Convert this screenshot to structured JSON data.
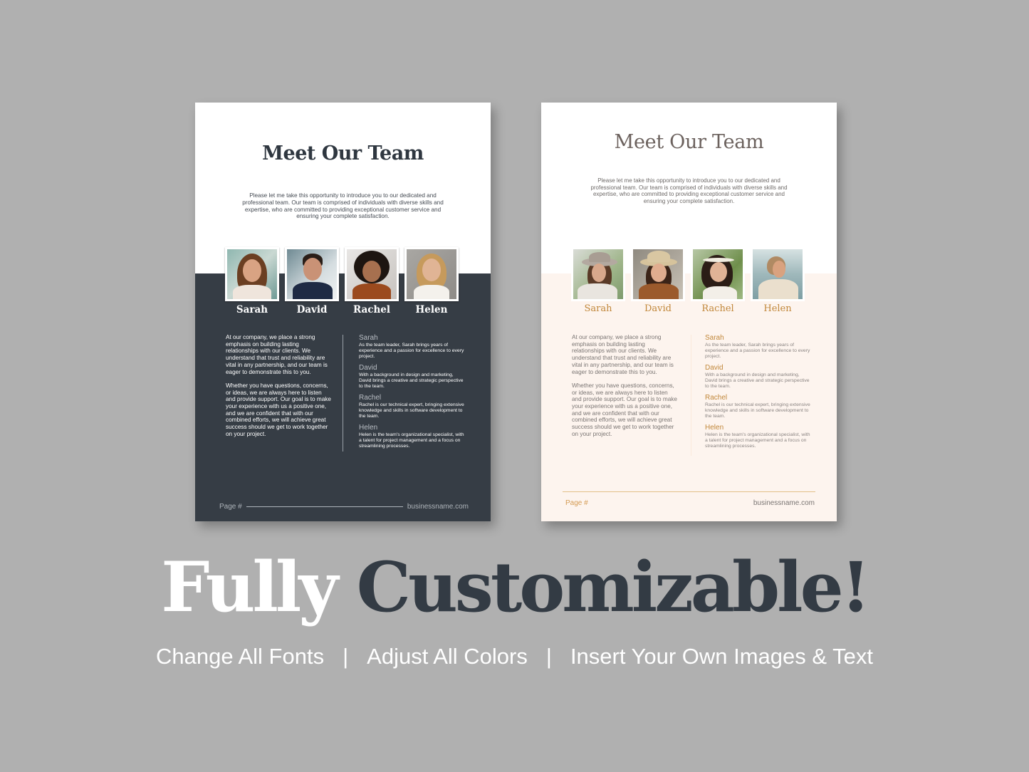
{
  "colors": {
    "background": "#b0b0b0",
    "dark_band": "#363d45",
    "light_band": "#fdf4ee",
    "accent_gold": "#c1873a",
    "title_dark": "#2f3740",
    "title_warm": "#6c625e"
  },
  "dark_page": {
    "title": "Meet Our Team",
    "intro": "Please let me take this opportunity to introduce you to our dedicated and professional team. Our team is comprised of individuals with diverse skills and expertise, who are committed to providing exceptional customer service and ensuring your complete satisfaction.",
    "members": [
      {
        "name": "Sarah",
        "photo": "smiling-woman-brown-hair-portrait"
      },
      {
        "name": "David",
        "photo": "smiling-man-suit-portrait"
      },
      {
        "name": "Rachel",
        "photo": "smiling-woman-curly-hair-portrait"
      },
      {
        "name": "Helen",
        "photo": "smiling-woman-blonde-hair-portrait"
      }
    ],
    "body_paragraphs": [
      "At our company, we place a strong emphasis on building lasting relationships with our clients. We understand that trust and reliability are vital in any partnership, and our team is eager to demonstrate this to you.",
      "Whether you have questions, concerns, or ideas, we are always here to listen and provide support. Our goal is to make your experience with us a positive one, and we are confident that with our combined efforts, we will achieve great success should we get to work together on your project."
    ],
    "bios": [
      {
        "name": "Sarah",
        "text": "As the team leader, Sarah brings years of experience and a passion for excellence to every project."
      },
      {
        "name": "David",
        "text": "With a background in design and marketing, David brings a creative and strategic perspective to the team."
      },
      {
        "name": "Rachel",
        "text": "Rachel is our technical expert, bringing extensive knowledge and skills in software development to the team."
      },
      {
        "name": "Helen",
        "text": "Helen is the team's organizational specialist, with a talent for project management and a focus on streamlining processes."
      }
    ],
    "footer": {
      "page": "Page #",
      "site": "businessname.com"
    }
  },
  "light_page": {
    "title": "Meet Our Team",
    "intro": "Please let me take this opportunity to introduce you to our dedicated and professional team. Our team is comprised of individuals with diverse skills and expertise, who are committed to providing exceptional customer service and ensuring your complete satisfaction.",
    "members": [
      {
        "name": "Sarah",
        "photo": "woman-wide-brim-hat-portrait"
      },
      {
        "name": "David",
        "photo": "woman-hat-sunglasses-portrait"
      },
      {
        "name": "Rachel",
        "photo": "woman-flower-crown-portrait"
      },
      {
        "name": "Helen",
        "photo": "woman-beach-boho-portrait"
      }
    ],
    "body_paragraphs": [
      "At our company, we place a strong emphasis on building lasting relationships with our clients. We understand that trust and reliability are vital in any partnership, and our team is eager to demonstrate this to you.",
      "Whether you have questions, concerns, or ideas, we are always here to listen and provide support. Our goal is to make your experience with us a positive one, and we are confident that with our combined efforts, we will achieve great success  should we get to work together on your project."
    ],
    "bios": [
      {
        "name": "Sarah",
        "text": "As the team leader, Sarah brings years of experience and a passion for excellence to every project."
      },
      {
        "name": "David",
        "text": "With a background in design and marketing, David brings a creative and strategic perspective to the team."
      },
      {
        "name": "Rachel",
        "text": "Rachel is our technical expert, bringing extensive knowledge and skills in software development to the team."
      },
      {
        "name": "Helen",
        "text": "Helen is the team's organizational specialist, with a talent for project management and a focus on streamlining processes."
      }
    ],
    "footer": {
      "page": "Page #",
      "site": "businessname.com"
    }
  },
  "headline": {
    "word1": "Fully",
    "word2": "Customizable!"
  },
  "features": [
    "Change All Fonts",
    "Adjust All Colors",
    "Insert Your Own Images & Text"
  ],
  "feature_separator": "|"
}
